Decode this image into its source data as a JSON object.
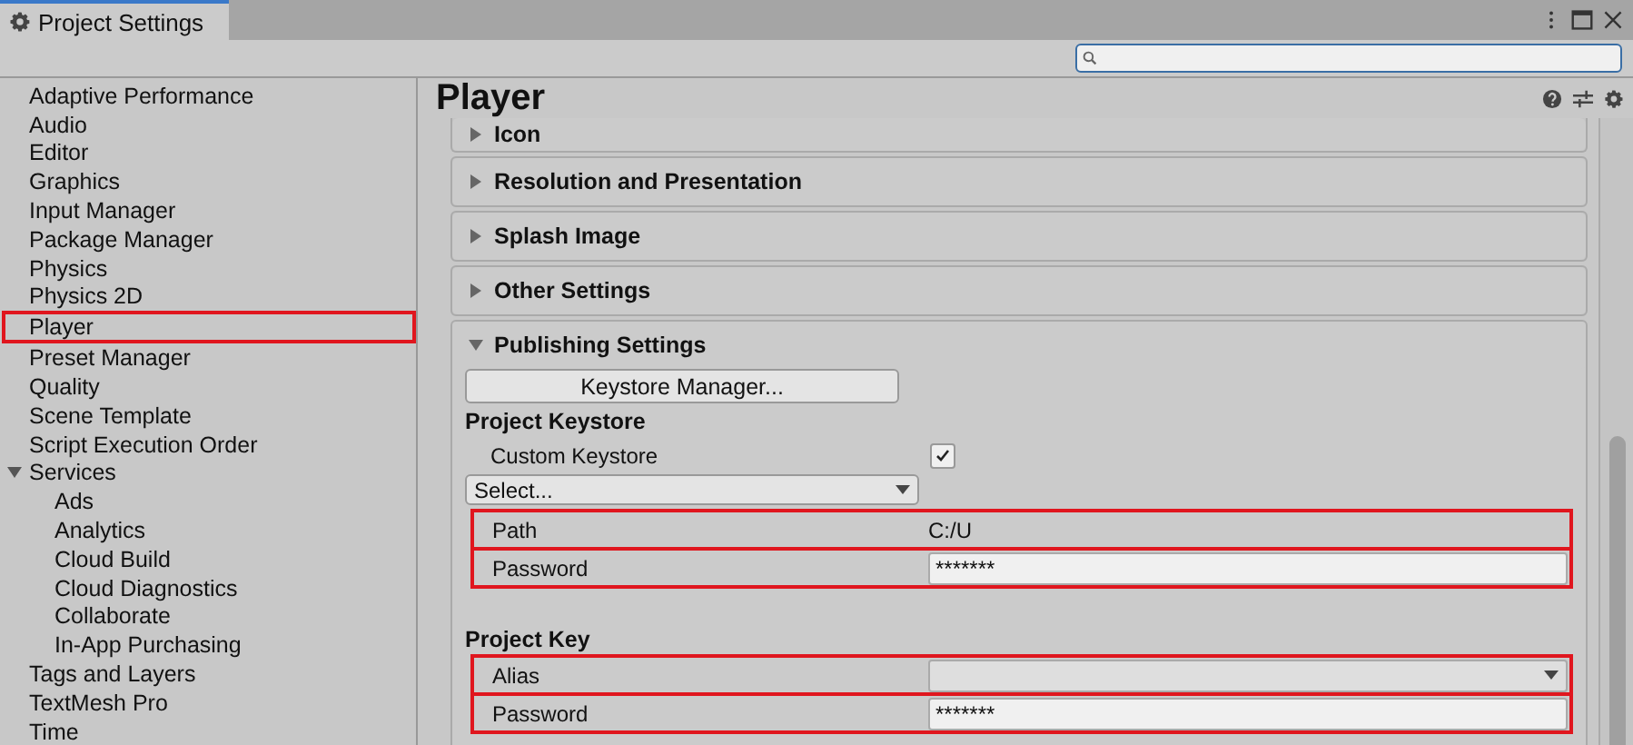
{
  "window": {
    "tab": "Project Settings"
  },
  "sidebar": {
    "items": [
      {
        "label": "Adaptive Performance",
        "highlighted": false
      },
      {
        "label": "Audio",
        "highlighted": false
      },
      {
        "label": "Editor",
        "highlighted": false
      },
      {
        "label": "Graphics",
        "highlighted": false
      },
      {
        "label": "Input Manager",
        "highlighted": false
      },
      {
        "label": "Package Manager",
        "highlighted": false
      },
      {
        "label": "Physics",
        "highlighted": false
      },
      {
        "label": "Physics 2D",
        "highlighted": false
      },
      {
        "label": "Player",
        "highlighted": true
      },
      {
        "label": "Preset Manager",
        "highlighted": false
      },
      {
        "label": "Quality",
        "highlighted": false
      },
      {
        "label": "Scene Template",
        "highlighted": false
      },
      {
        "label": "Script Execution Order",
        "highlighted": false
      },
      {
        "label": "Services",
        "highlighted": false,
        "expanded": true,
        "children": [
          {
            "label": "Ads",
            "highlighted": false
          },
          {
            "label": "Analytics",
            "highlighted": false
          },
          {
            "label": "Cloud Build",
            "highlighted": false
          },
          {
            "label": "Cloud Diagnostics",
            "highlighted": false
          },
          {
            "label": "Collaborate",
            "highlighted": false
          },
          {
            "label": "In-App Purchasing",
            "highlighted": false
          }
        ]
      },
      {
        "label": "Tags and Layers",
        "highlighted": false
      },
      {
        "label": "TextMesh Pro",
        "highlighted": false
      },
      {
        "label": "Time",
        "highlighted": false
      }
    ]
  },
  "title": "Player",
  "sections": [
    {
      "label": "Icon",
      "expanded": false
    },
    {
      "label": "Resolution and Presentation",
      "expanded": false
    },
    {
      "label": "Splash Image",
      "expanded": false
    },
    {
      "label": "Other Settings",
      "expanded": false
    },
    {
      "label": "Publishing Settings",
      "expanded": true
    }
  ],
  "publishing": {
    "button": "Keystore Manager...",
    "keystore_heading": "Project Keystore",
    "custom_keystore": {
      "label": "Custom Keystore",
      "checked": true
    },
    "select": "Select...",
    "keystore_rows": [
      {
        "kind": "text",
        "label": "Path",
        "value": "C:/U",
        "highlighted": true
      },
      {
        "kind": "password",
        "label": "Password",
        "value": "*******",
        "highlighted": true
      }
    ],
    "key_heading": "Project Key",
    "key_rows": [
      {
        "kind": "dropdown",
        "label": "Alias",
        "highlighted": true
      },
      {
        "kind": "password",
        "label": "Password",
        "value": "*******",
        "highlighted": true
      }
    ]
  }
}
